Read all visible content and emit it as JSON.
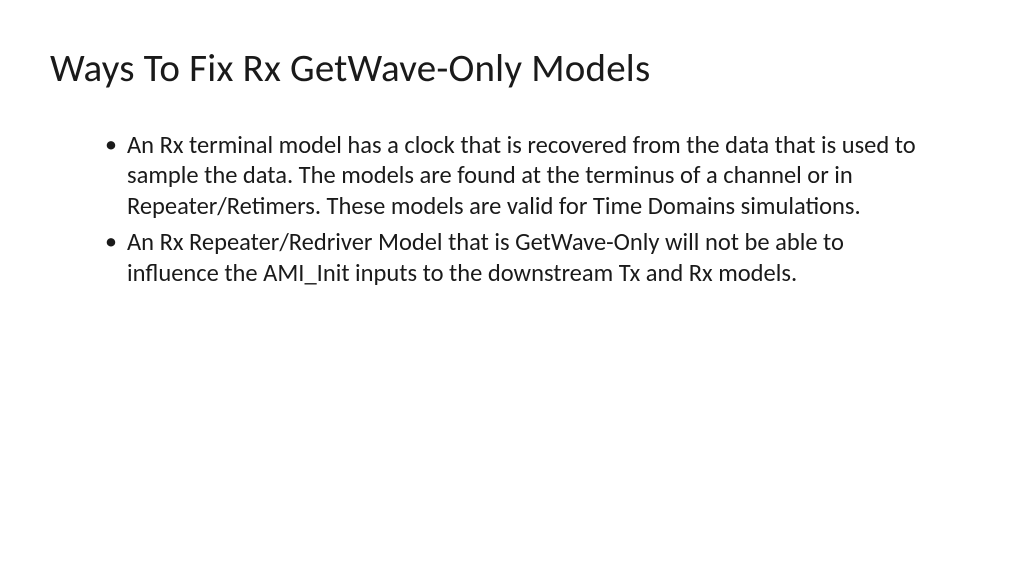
{
  "slide": {
    "title": "Ways To Fix Rx GetWave-Only Models",
    "bullets": [
      "An Rx terminal model has a clock that is recovered from the data that is used to sample the data. The models are found at the terminus of a channel or in Repeater/Retimers. These models are valid for Time Domains simulations.",
      "An Rx Repeater/Redriver Model that is GetWave-Only will not be able to influence the AMI_Init inputs to the downstream Tx and Rx models."
    ]
  }
}
